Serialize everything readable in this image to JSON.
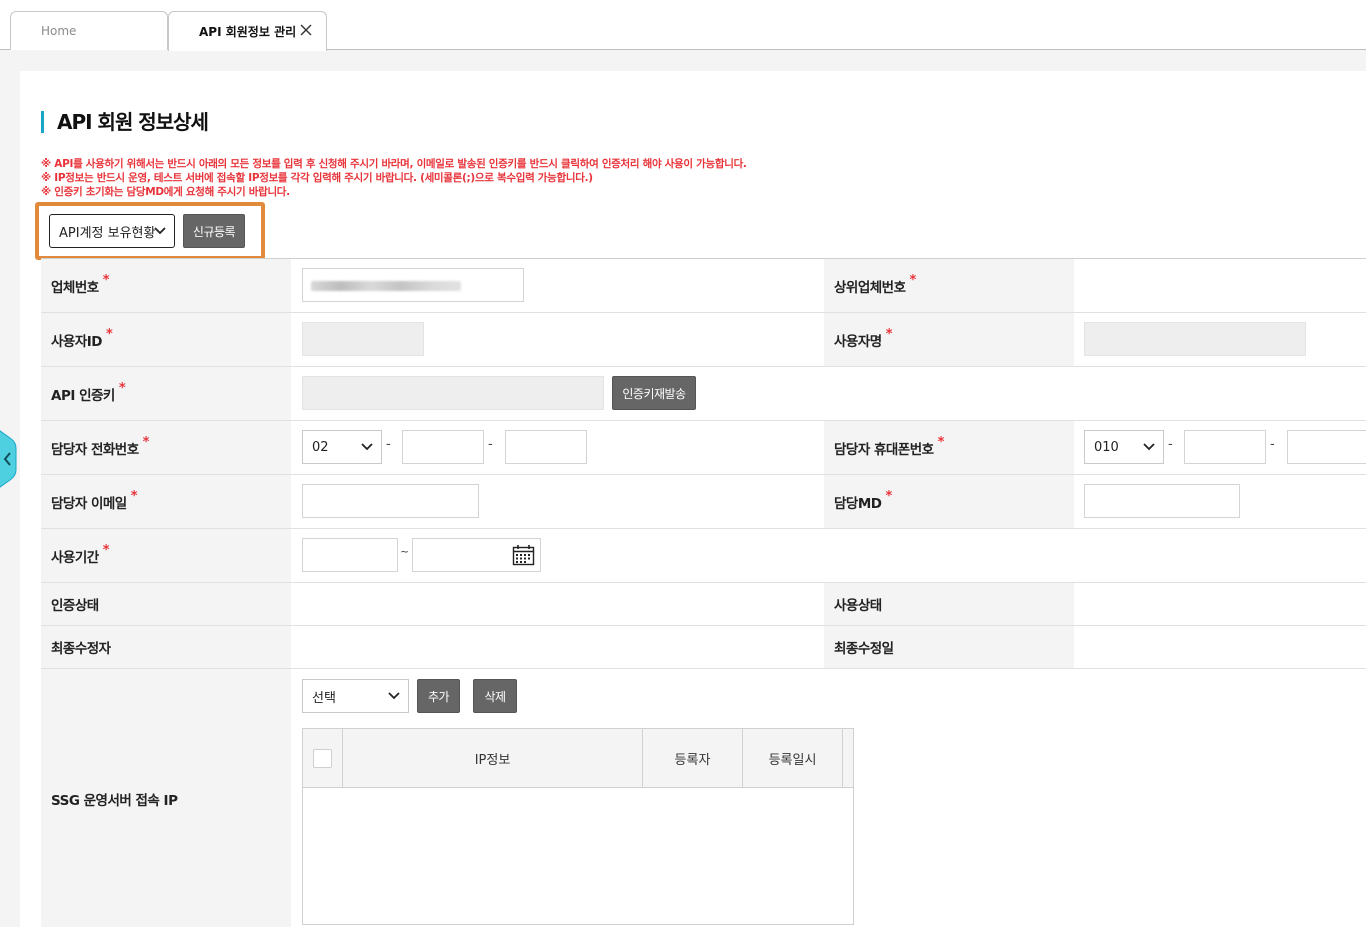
{
  "tabs": [
    {
      "label": "Home"
    },
    {
      "label": "API 회원정보 관리"
    }
  ],
  "page": {
    "title": "API 회원 정보상세",
    "notices": [
      "※ API를 사용하기 위해서는 반드시 아래의 모든 정보를 입력 후 신청해 주시기 바라며, 이메일로 발송된 인증키를 반드시 클릭하여 인증처리 해야 사용이 가능합니다.",
      "※ IP정보는 반드시 운영, 테스트 서버에 접속할 IP정보를 각각 입력해 주시기 바랍니다. (세미콜론(;)으로 복수입력 가능합니다.)",
      "※ 인증키 초기화는 담당MD에게 요청해 주시기 바랍니다."
    ]
  },
  "toolbar": {
    "account_select": "API계정 보유현황",
    "register_button": "신규등록"
  },
  "form": {
    "required_mark": "*",
    "vendor_no_label": "업체번호",
    "parent_vendor_no_label": "상위업체번호",
    "user_id_label": "사용자ID",
    "user_name_label": "사용자명",
    "api_key_label": "API 인증키",
    "reissue_key_button": "인증키재발송",
    "manager_phone_label": "담당자 전화번호",
    "phone_area": "02",
    "manager_mobile_label": "담당자 휴대폰번호",
    "mobile_prefix": "010",
    "dash": "-",
    "manager_email_label": "담당자 이메일",
    "md_label": "담당MD",
    "period_label": "사용기간",
    "period_separator": "~",
    "auth_status_label": "인증상태",
    "use_status_label": "사용상태",
    "last_editor_label": "최종수정자",
    "last_edit_date_label": "최종수정일",
    "ssg_ip_label": "SSG 운영서버 접속 IP",
    "ip_select": "선택",
    "add_button": "추가",
    "delete_button": "삭제",
    "ip_table_headers": [
      "IP정보",
      "등록자",
      "등록일시"
    ]
  },
  "colors": {
    "accent_bar": "#1aa6c8",
    "highlight_box": "#e28a3c",
    "notice_red": "#e8343a",
    "button_gray": "#666666"
  },
  "icons": [
    "close-icon",
    "chevron-down-icon",
    "calendar-icon",
    "chevron-left-icon"
  ]
}
